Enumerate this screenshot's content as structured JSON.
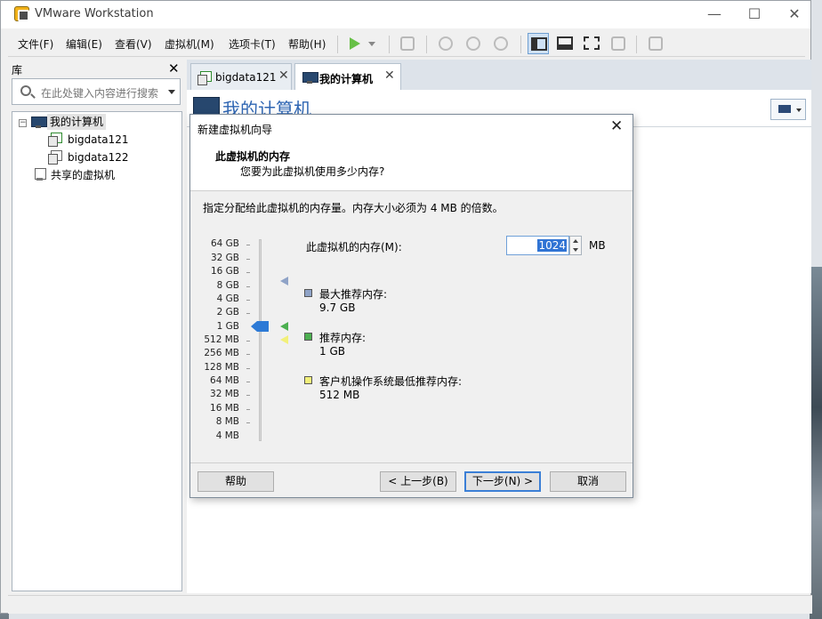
{
  "window": {
    "title": "VMware Workstation"
  },
  "menu": [
    "文件(F)",
    "编辑(E)",
    "查看(V)",
    "虚拟机(M)",
    "选项卡(T)",
    "帮助(H)"
  ],
  "library": {
    "title": "库",
    "search_placeholder": "在此处键入内容进行搜索",
    "tree": {
      "root": "我的计算机",
      "vms": [
        "bigdata121",
        "bigdata122"
      ],
      "shared": "共享的虚拟机"
    }
  },
  "tabs": [
    {
      "label": "bigdata121",
      "icon": "vm-running-icon"
    },
    {
      "label": "我的计算机",
      "icon": "computer-icon"
    }
  ],
  "content": {
    "title": "我的计算机"
  },
  "dialog": {
    "title": "新建虚拟机向导",
    "heading": "此虚拟机的内存",
    "subheading": "您要为此虚拟机使用多少内存?",
    "description": "指定分配给此虚拟机的内存量。内存大小必须为 4 MB 的倍数。",
    "scale": [
      "64 GB",
      "32 GB",
      "16 GB",
      "8 GB",
      "4 GB",
      "2 GB",
      "1 GB",
      "512 MB",
      "256 MB",
      "128 MB",
      "64 MB",
      "32 MB",
      "16 MB",
      "8 MB",
      "4 MB"
    ],
    "memory": {
      "label": "此虚拟机的内存(M):",
      "value": "1024",
      "unit": "MB",
      "selected_scale": "1 GB"
    },
    "legend": [
      {
        "title": "最大推荐内存:",
        "value": "9.7 GB",
        "color": "#8fa3c7"
      },
      {
        "title": "推荐内存:",
        "value": "1 GB",
        "color": "#4caf50"
      },
      {
        "title": "客户机操作系统最低推荐内存:",
        "value": "512 MB",
        "color": "#f2f07a"
      }
    ],
    "buttons": {
      "help": "帮助",
      "back": "< 上一步(B)",
      "next": "下一步(N) >",
      "cancel": "取消"
    }
  }
}
